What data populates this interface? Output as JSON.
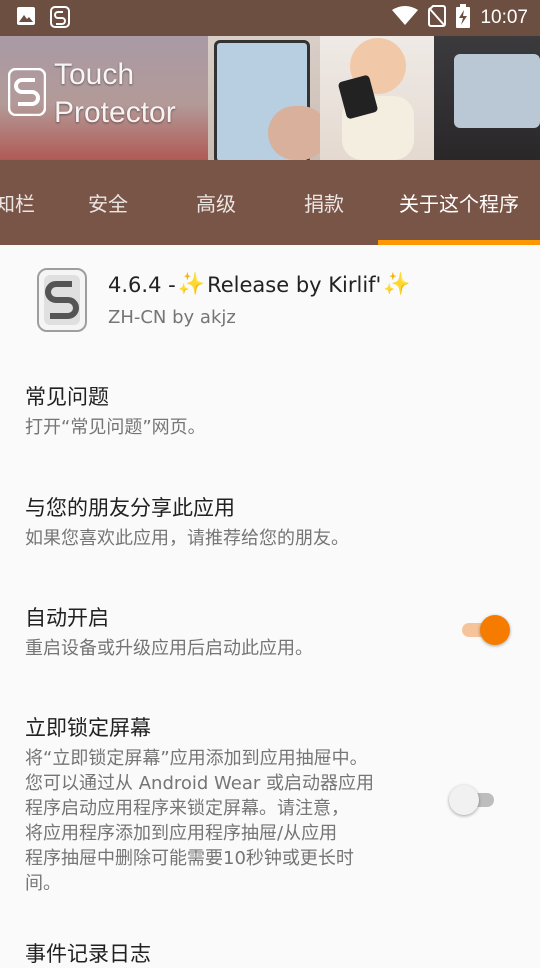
{
  "status_bar": {
    "time": "10:07",
    "icons": [
      "image-icon",
      "app-notification-icon",
      "wifi-icon",
      "no-sim-icon",
      "battery-charging-icon"
    ]
  },
  "header": {
    "app_name_line1": "Touch",
    "app_name_line2": "Protector"
  },
  "tabs": [
    {
      "label": "知栏",
      "active": false
    },
    {
      "label": "安全",
      "active": false
    },
    {
      "label": "高级",
      "active": false
    },
    {
      "label": "捐款",
      "active": false
    },
    {
      "label": "关于这个程序",
      "active": true
    }
  ],
  "about": {
    "version_prefix": "4.6.4 - ",
    "release_text": "Release by Kirlif'",
    "sparkle": "✨",
    "translator": "ZH-CN by akjz"
  },
  "preferences": [
    {
      "title": "常见问题",
      "summary": "打开“常见问题”网页。"
    },
    {
      "title": "与您的朋友分享此应用",
      "summary": "如果您喜欢此应用，请推荐给您的朋友。"
    },
    {
      "title": "自动开启",
      "summary": "重启设备或升级应用后启动此应用。",
      "toggle": true,
      "enabled": true
    },
    {
      "title": "立即锁定屏幕",
      "summary_lines": [
        "将“立即锁定屏幕”应用添加到应用抽屉中。",
        "您可以通过从 Android Wear 或启动器应用",
        "程序启动应用程序来锁定屏幕。请注意，",
        "将应用程序添加到应用程序抽屉/从应用",
        "程序抽屉中删除可能需要10秒钟或更长时",
        "间。"
      ],
      "toggle": true,
      "enabled": false
    },
    {
      "title": "事件记录日志"
    }
  ],
  "colors": {
    "status_bar": "#6d4f42",
    "tab_bar": "#795548",
    "accent": "#ff9800",
    "switch_on": "#f57c00"
  }
}
